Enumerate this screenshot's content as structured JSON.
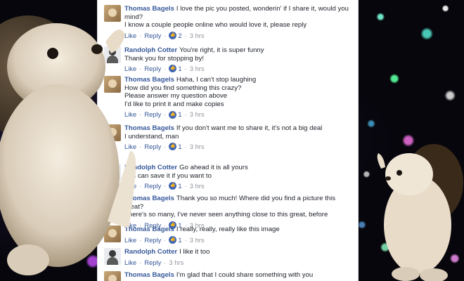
{
  "comments": [
    {
      "author": "Thomas Bagels",
      "avatar": "thomas-avatar",
      "lines": [
        "I love the pic you posted, wonderin' if I share it, would you",
        "mind?",
        "I know a couple people online who would love it, please reply"
      ],
      "like": "Like",
      "reply": "Reply",
      "likes": "2",
      "time": "3 hrs"
    },
    {
      "author": "Randolph Cotter",
      "avatar": "randolph-avatar",
      "lines": [
        "You're right, it is super funny",
        "Thank you for stopping by!"
      ],
      "like": "Like",
      "reply": "Reply",
      "likes": "1",
      "time": "3 hrs"
    },
    {
      "author": "Thomas Bagels",
      "avatar": "thomas-avatar",
      "lines": [
        "Haha, I can't stop laughing",
        "How did you find something this crazy?",
        "Please answer my question above",
        "I'd like to print it and make copies"
      ],
      "like": "Like",
      "reply": "Reply",
      "likes": "1",
      "time": "3 hrs"
    },
    {
      "author": "Thomas Bagels",
      "avatar": "thomas-avatar",
      "lines": [
        "If you don't want me to share it, it's not a big deal",
        "I understand, man"
      ],
      "like": "Like",
      "reply": "Reply",
      "likes": "1",
      "time": "3 hrs"
    },
    {
      "author": "Randolph Cotter",
      "avatar": "randolph-avatar",
      "lines": [
        "Go ahead it is all yours",
        "You can save it if you want to"
      ],
      "like": "Like",
      "reply": "Reply",
      "likes": "1",
      "time": "3 hrs"
    },
    {
      "author": "Thomas Bagels",
      "avatar": "thomas-avatar",
      "lines": [
        "Thank you so much! Where did you find a picture this great?",
        "There's so many, I've never seen anything close to this great, before"
      ],
      "like": "Like",
      "reply": "Reply",
      "likes": "1",
      "time": "3 hrs"
    },
    {
      "author": "Thomas Bagels",
      "avatar": "thomas-avatar",
      "lines": [
        "I really, really, really like this image"
      ],
      "like": "Like",
      "reply": "Reply",
      "likes": "1",
      "time": "3 hrs"
    },
    {
      "author": "Randolph Cotter",
      "avatar": "randolph-avatar",
      "lines": [
        "I like it too"
      ],
      "like": "Like",
      "reply": "Reply",
      "likes": "",
      "time": "3 hrs"
    },
    {
      "author": "Thomas Bagels",
      "avatar": "thomas-avatar",
      "lines": [
        "I'm glad that I could share something with you"
      ],
      "like": "",
      "reply": "",
      "likes": "",
      "time": ""
    }
  ],
  "colors": {
    "link": "#365899",
    "meta": "#90949c",
    "text": "#1d2129",
    "like_badge": "#4267b2"
  },
  "icons": {
    "like_badge": "thumbs-up-icon",
    "dance_left": "hedgehog-dancing",
    "dance_right": "hedgehog-dancing"
  }
}
